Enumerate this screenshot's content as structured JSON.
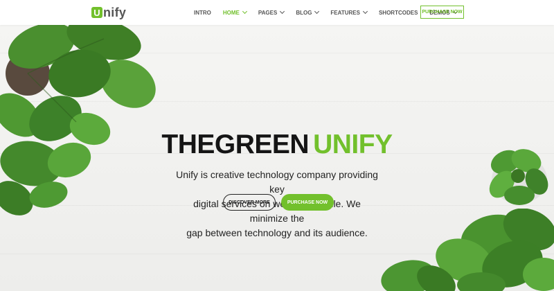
{
  "brand": {
    "logo_letter": "U",
    "logo_rest": "nify",
    "accent": "#72c02c"
  },
  "nav": {
    "items": [
      {
        "label": "INTRO",
        "dropdown": false,
        "active": false
      },
      {
        "label": "HOME",
        "dropdown": true,
        "active": true
      },
      {
        "label": "PAGES",
        "dropdown": true,
        "active": false
      },
      {
        "label": "BLOG",
        "dropdown": true,
        "active": false
      },
      {
        "label": "FEATURES",
        "dropdown": true,
        "active": false
      },
      {
        "label": "SHORTCODES",
        "dropdown": false,
        "active": false
      },
      {
        "label": "DEMOS",
        "dropdown": true,
        "active": false
      }
    ],
    "purchase_label": "PURCHASE NOW"
  },
  "hero": {
    "title_part1": "THEGREEN",
    "title_part2": "UNIFY",
    "subtitle_line1": "Unify is creative technology company providing key",
    "subtitle_line2": "digital services on web and mobile. We minimize the",
    "subtitle_line3": "gap between technology and its audience.",
    "discover_label": "DISCOVER MORE",
    "purchase_label": "PURCHASE NOW"
  }
}
